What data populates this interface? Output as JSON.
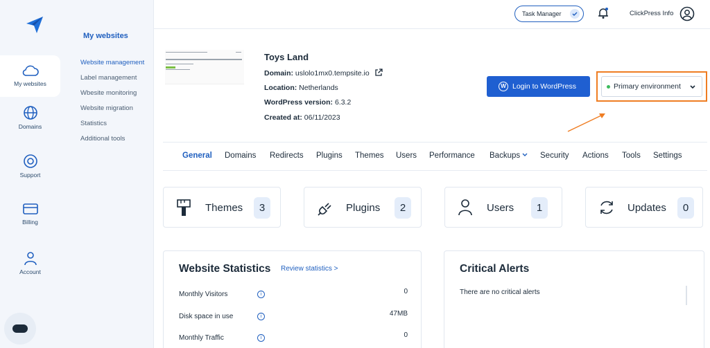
{
  "sidebar": {
    "items": [
      {
        "label": "My websites",
        "icon": "cloud-icon",
        "active": true
      },
      {
        "label": "Domains",
        "icon": "globe-icon"
      },
      {
        "label": "Support",
        "icon": "lifebuoy-icon"
      },
      {
        "label": "Billing",
        "icon": "credit-card-icon"
      },
      {
        "label": "Account",
        "icon": "user-icon"
      }
    ]
  },
  "subnav": {
    "title": "My websites",
    "items": [
      "Website management",
      "Label management",
      "Wbesite monitoring",
      "Website migration",
      "Statistics",
      "Additional tools"
    ]
  },
  "header": {
    "task_manager": "Task Manager",
    "user_name": "ClickPress Info"
  },
  "site": {
    "name": "Toys Land",
    "domain_label": "Domain:",
    "domain": "uslolo1mx0.tempsite.io",
    "location_label": "Location:",
    "location": "Netherlands",
    "wp_version_label": "WordPress version:",
    "wp_version": "6.3.2",
    "created_label": "Created at:",
    "created": "06/11/2023"
  },
  "actions": {
    "login_wp": "Login to WordPress",
    "environment": "Primary environment"
  },
  "tabs": [
    "General",
    "Domains",
    "Redirects",
    "Plugins",
    "Themes",
    "Users",
    "Performance",
    "Backups",
    "Security",
    "Actions",
    "Tools",
    "Settings"
  ],
  "cards": [
    {
      "label": "Themes",
      "count": "3",
      "icon": "brush-icon"
    },
    {
      "label": "Plugins",
      "count": "2",
      "icon": "plug-icon"
    },
    {
      "label": "Users",
      "count": "1",
      "icon": "user-icon"
    },
    {
      "label": "Updates",
      "count": "0",
      "icon": "refresh-icon"
    }
  ],
  "statistics": {
    "title": "Website Statistics",
    "review_link": "Review statistics >",
    "rows": [
      {
        "label": "Monthly Visitors",
        "value": "0"
      },
      {
        "label": "Disk space in use",
        "value": "47MB"
      },
      {
        "label": "Monthly Traffic",
        "value": "0"
      }
    ]
  },
  "alerts": {
    "title": "Critical Alerts",
    "empty_text": "There are no critical alerts"
  },
  "colors": {
    "accent": "#1f5fbf",
    "primary_button": "#1f5fd1",
    "highlight_box": "#ef7d22",
    "status_dot": "#3dbb5d"
  }
}
